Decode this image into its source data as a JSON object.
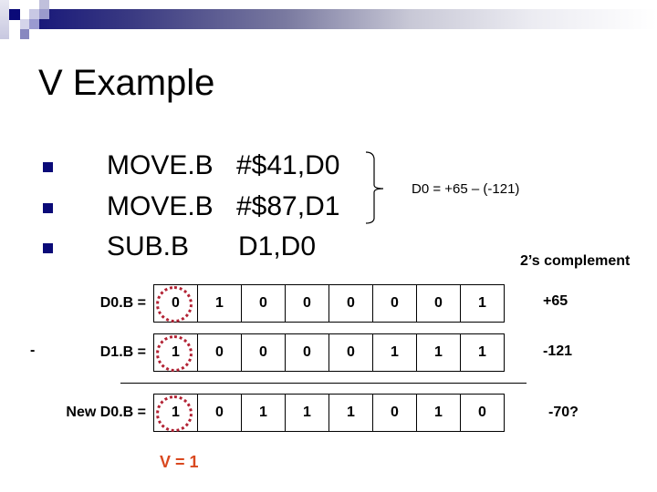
{
  "slide": {
    "title": "V Example",
    "code_lines": [
      {
        "op": "MOVE.B",
        "args": "#$41,D0"
      },
      {
        "op": "MOVE.B",
        "args": "#$87,D1"
      },
      {
        "op": "SUB.B",
        "args": "D1,D0"
      }
    ],
    "brace_note": "D0 = +65 – (-121)",
    "complement_note": "2’s complement",
    "operator": "-",
    "rows": [
      {
        "label": "D0.B =",
        "bits": [
          "0",
          "1",
          "0",
          "0",
          "0",
          "0",
          "0",
          "1"
        ],
        "value": "+65"
      },
      {
        "label": "D1.B =",
        "bits": [
          "1",
          "0",
          "0",
          "0",
          "0",
          "1",
          "1",
          "1"
        ],
        "value": "-121"
      },
      {
        "label": "New D0.B =",
        "bits": [
          "1",
          "0",
          "1",
          "1",
          "1",
          "0",
          "1",
          "0"
        ],
        "value": "-70?"
      }
    ],
    "overflow_flag": "V = 1",
    "colors": {
      "accent_navy": "#0a0a78",
      "circle_red": "#b22234",
      "overflow_orange": "#d9481f"
    }
  }
}
